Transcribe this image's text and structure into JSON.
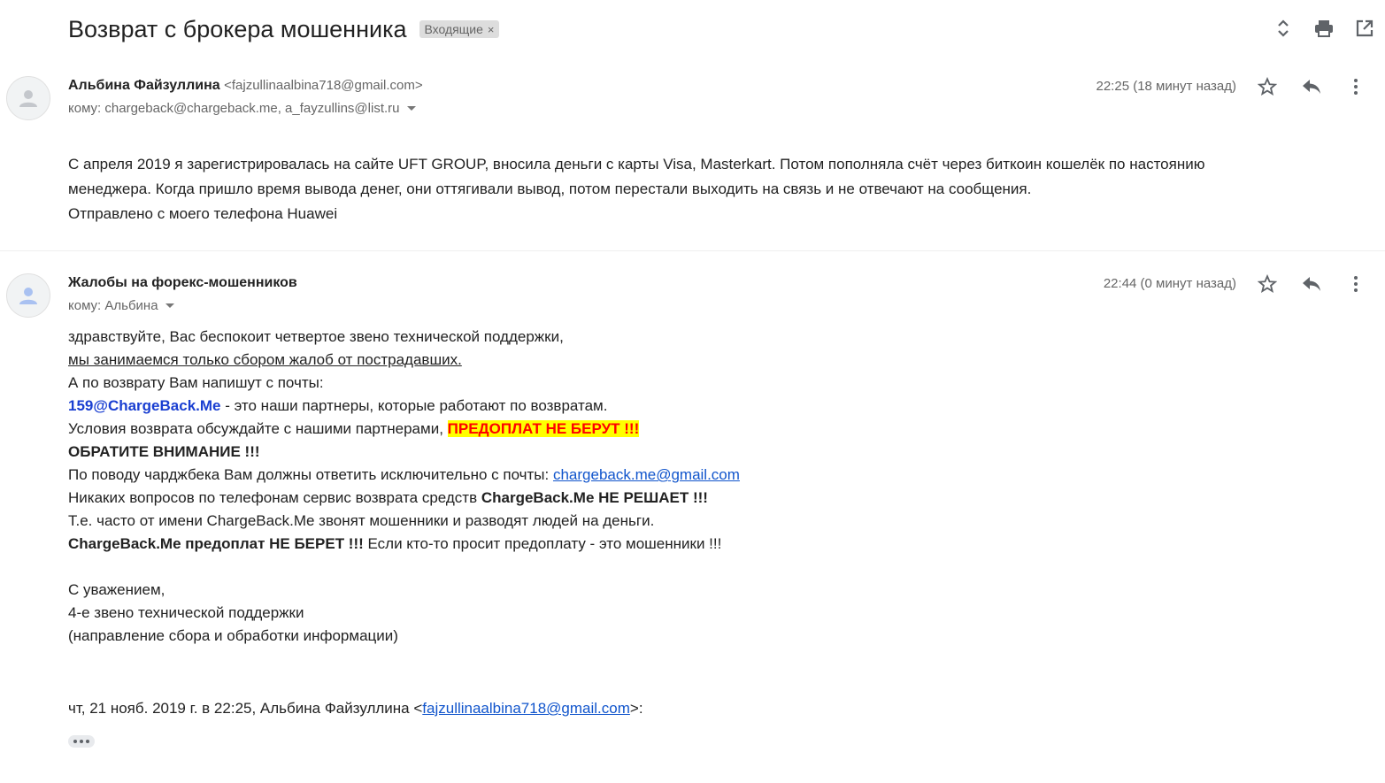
{
  "subject": "Возврат с брокера мошенника",
  "label": {
    "text": "Входящие",
    "remove": "×"
  },
  "toolbar": {
    "icons": [
      "expand-collapse-icon",
      "print-icon",
      "open-in-new-window-icon"
    ]
  },
  "messages": [
    {
      "sender_name": "Альбина Файзуллина",
      "sender_email": "<fajzullinaalbina718@gmail.com>",
      "to": "кому: chargeback@chargeback.me, a_fayzullins@list.ru",
      "time": "22:25 (18 минут назад)",
      "body": [
        "С апреля 2019 я зарегистрировалась на сайте UFT GROUP, вносила деньги с карты Visa, Masterkart. Потом пополняла счёт через биткоин кошелёк по настоянию",
        "менеджера. Когда пришло время вывода денег, они оттягивали вывод, потом перестали выходить на связь и не отвечают на сообщения.",
        "Отправлено с моего телефона Huawei"
      ]
    },
    {
      "sender_name": "Жалобы на форекс-мошенников",
      "to": "кому: Альбина",
      "time": "22:44 (0 минут назад)",
      "body": {
        "l1": "здравствуйте, Вас беспокоит четвертое звено технической поддержки,",
        "l2": "мы занимаемся только сбором жалоб от пострадавших.",
        "l3": "А по возврату Вам напишут с почты:",
        "l4_email": "159@ChargeBack.Me",
        "l4_rest": " - это наши партнеры, которые работают по возвратам.",
        "l5_text": "Условия возврата обсуждайте с нашими партнерами, ",
        "l5_highlight": "ПРЕДОПЛАТ НЕ БЕРУТ !!!",
        "l6": "ОБРАТИТЕ ВНИМАНИЕ !!!",
        "l7_text": "По поводу чарджбека Вам должны ответить исключительно с почты: ",
        "l7_link": "chargeback.me@gmail.com",
        "l8_text": "Никаких вопросов по телефонам сервис возврата средств ",
        "l8_bold": "ChargeBack.Me НЕ РЕШАЕТ !!!",
        "l9": "Т.е. часто от имени ChargeBack.Me звонят мошенники и разводят людей на деньги.",
        "l10_bold": "ChargeBack.Me предоплат НЕ БЕРЕТ !!!",
        "l10_rest": " Если кто-то просит предоплату - это мошенники !!!",
        "sig1": "С уважением,",
        "sig2": "4-е звено технической поддержки",
        "sig3": "(направление сбора и обработки информации)",
        "quote_prefix": "чт, 21 нояб. 2019 г. в 22:25, Альбина Файзуллина <",
        "quote_link": "fajzullinaalbina718@gmail.com",
        "quote_suffix": ">:"
      }
    }
  ],
  "message_icons": [
    "star-icon",
    "reply-icon",
    "more-vert-icon"
  ]
}
